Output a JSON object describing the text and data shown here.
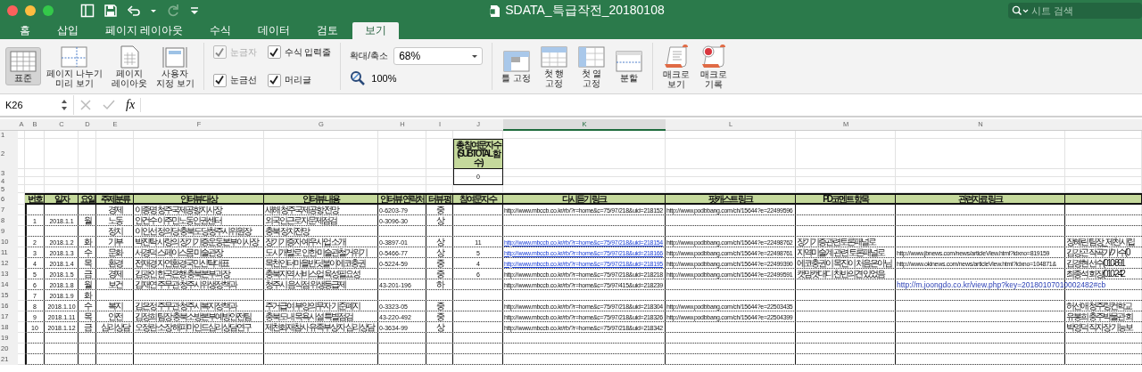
{
  "window": {
    "title": "SDATA_특급작전_20180108",
    "search_placeholder": "시트 검색"
  },
  "tabs": [
    {
      "label": "홈",
      "selected": false
    },
    {
      "label": "삽입",
      "selected": false
    },
    {
      "label": "페이지 레이아웃",
      "selected": false
    },
    {
      "label": "수식",
      "selected": false
    },
    {
      "label": "데이터",
      "selected": false
    },
    {
      "label": "검토",
      "selected": false
    },
    {
      "label": "보기",
      "selected": true
    }
  ],
  "ribbon": {
    "views": [
      {
        "label": "표준",
        "kind": "normal",
        "selected": true
      },
      {
        "label": "페이지 나누기\n미리 보기",
        "kind": "page_break",
        "selected": false
      },
      {
        "label": "페이지\n레이아웃",
        "kind": "page_layout",
        "selected": false
      },
      {
        "label": "사용자\n지정 보기",
        "kind": "custom",
        "selected": false
      }
    ],
    "view_options": [
      {
        "label": "눈금자",
        "checked": true,
        "disabled": true
      },
      {
        "label": "수식 입력줄",
        "checked": true,
        "disabled": false
      },
      {
        "label": "눈금선",
        "checked": true,
        "disabled": false
      },
      {
        "label": "머리글",
        "checked": true,
        "disabled": false
      }
    ],
    "zoom": {
      "label": "확대/축소",
      "value": "68%",
      "reset_label": "100%"
    },
    "freeze": [
      {
        "label": "틀 고정",
        "kind": "panes"
      },
      {
        "label": "첫 행\n고정",
        "kind": "top_row"
      },
      {
        "label": "첫 열\n고정",
        "kind": "first_column"
      },
      {
        "label": "분할",
        "kind": "split"
      }
    ],
    "macros": [
      {
        "label": "매크로\n보기",
        "kind": "view"
      },
      {
        "label": "매크로\n기록",
        "kind": "record"
      }
    ]
  },
  "formula_bar": {
    "cell": "K26",
    "function_label": "fx"
  },
  "sheet": {
    "column_headers": [
      {
        "label": "A",
        "selected": false
      },
      {
        "label": "B",
        "selected": false
      },
      {
        "label": "C",
        "selected": false
      },
      {
        "label": "D",
        "selected": false
      },
      {
        "label": "E",
        "selected": false
      },
      {
        "label": "F",
        "selected": false
      },
      {
        "label": "G",
        "selected": false
      },
      {
        "label": "H",
        "selected": false
      },
      {
        "label": "I",
        "selected": false
      },
      {
        "label": "J",
        "selected": false
      },
      {
        "label": "K",
        "selected": true
      },
      {
        "label": "L",
        "selected": false
      },
      {
        "label": "M",
        "selected": false
      },
      {
        "label": "N",
        "selected": false
      }
    ],
    "row_numbers": [
      "1",
      "2",
      "3",
      "4",
      "5",
      "6",
      "7",
      "8",
      "9",
      "10",
      "11",
      "12",
      "13",
      "14",
      "15",
      "16",
      "17",
      "18",
      "19",
      "20",
      "21"
    ],
    "summary": {
      "label": "총 참여문자 수 (SUBTOTAL 함수)",
      "value": "0"
    },
    "headers": [
      "번호",
      "일자",
      "요일",
      "주제분류",
      "인터뷰 대상",
      "인터뷰 내용",
      "인터뷰 연락처",
      "터뷰 평",
      "참여문자 수",
      "다시듣기 링크",
      "팟캐스트 링크",
      "PD코멘트 항목",
      "관련자료 링크"
    ],
    "entries": [
      {
        "no": "1",
        "date": "2018.1.1",
        "day": "월",
        "lines": [
          {
            "topic": "경제",
            "target": "이종명 청주국제공항지사장",
            "content": "새해 청주국제공항 전망",
            "phone": "0-6203-79",
            "rating": "중",
            "replay": {
              "text": "http://www.mbccb.co.kr/rb/?r=home&c=75/97/218&uid=218152",
              "hyperlink": false
            },
            "podcast": "http://www.podbbang.com/ch/15644?e=22499596"
          },
          {
            "topic": "노동",
            "target": "안건수 이주민노동인권센터",
            "content": "외국인근로자문제점검",
            "phone": "0-3096-30",
            "rating": "상"
          },
          {
            "topic": "정치",
            "target": "이인선 정의당 충북도당 청주시위원장",
            "content": "충북 정치전망"
          }
        ]
      },
      {
        "no": "2",
        "date": "2018.1.2",
        "day": "화",
        "lines": [
          {
            "topic": "기부",
            "target": "박진탁 사랑의 장기기증운동본부 이사장",
            "content": "장기기증자 예우사업 소개",
            "phone": "0-3897-01",
            "rating": "상",
            "count": "11",
            "replay": {
              "text": "http://www.mbccb.co.kr/rb/?r=home&c=75/97/218&uid=218154",
              "hyperlink": true
            },
            "podcast": "http://www.podbbang.com/ch/15644?e=22498762",
            "pd_comment": "장기기증관련토론패널로",
            "guest": "장혜린 팀장_제천시립"
          }
        ]
      },
      {
        "no": "3",
        "date": "2018.1.3",
        "day": "수",
        "lines": [
          {
            "topic": "문화",
            "target": "서경덕 스페이스몸 미술관장",
            "content": "도시개발로 인한 미술관 철거위기",
            "phone": "0-5466-77",
            "rating": "상",
            "count": "5",
            "replay": {
              "text": "http://www.mbccb.co.kr/rb/?r=home&c=75/97/218&uid=218166",
              "hyperlink": true
            },
            "podcast": "http://www.podbbang.com/ch/15644?e=22498761",
            "pd_comment": "지역미술계 관련 토론 패널로",
            "related": {
              "text": "http://www.jbnews.com/news/articleView.html?idxno=819159",
              "hyperlink": false
            },
            "guest": "김강곤 작곡가/가수(0"
          }
        ]
      },
      {
        "no": "4",
        "date": "2018.1.4",
        "day": "목",
        "lines": [
          {
            "topic": "환경",
            "target": "전재경 자연환경국민신탁대표",
            "content": "목천인터마을반딧불이에코충권",
            "phone": "0-5224-59",
            "rating": "중",
            "count": "4",
            "replay": {
              "text": "http://www.mbccb.co.kr/rb/?r=home&c=75/97/218&uid=218195",
              "hyperlink": true
            },
            "podcast": "http://www.podbbang.com/ch/15644?e=22499390",
            "pd_comment": "에코충권이 목진이 처음은 아님",
            "related": {
              "text": "http://www.okinews.com/news/articleView.html?idxno=104871&",
              "hyperlink": false
            },
            "guest": "김경현 선수(010-891"
          }
        ]
      },
      {
        "no": "5",
        "date": "2018.1.5",
        "day": "금",
        "lines": [
          {
            "topic": "경제",
            "target": "김광인 한국은행 충북본부 과장",
            "content": "충북지역 서비스업 육성 필요성",
            "rating": "중",
            "count": "6",
            "replay": {
              "text": "http://www.mbccb.co.kr/rb/?r=home&c=75/97/218&uid=218218",
              "hyperlink": false
            },
            "podcast": "http://www.podbbang.com/ch/15644?e=22499591",
            "pd_comment": "캣맘캣대디 찬반의견 있었음",
            "guest": "최종석 회장(010-242"
          }
        ]
      },
      {
        "no": "6",
        "date": "2018.1.8",
        "day": "월",
        "lines": [
          {
            "topic": "보건",
            "target": "김재연 주무관 청주시 위생정책과",
            "content": "청주시 음식점 위생등급제",
            "phone": "43-201-196",
            "rating": "하",
            "replay": {
              "text": "http://www.mbccb.co.kr/rb/?r=home&c=75/97/415&uid=218239",
              "hyperlink": false
            },
            "related": {
              "text": "http://m.joongdo.co.kr/view.php?key=20180107010002482#cb",
              "hyperlink": true
            }
          }
        ]
      },
      {
        "no": "7",
        "date": "2018.1.9",
        "day": "화"
      },
      {
        "no": "8",
        "date": "2018.1.10",
        "day": "수",
        "lines": [
          {
            "topic": "복지",
            "target": "김은정 주무관 청주시 복지정책과",
            "content": "주거급여 부양의무자 기준 폐지",
            "phone": "0-3323-05",
            "rating": "중",
            "replay": {
              "text": "http://www.mbccb.co.kr/rb/?r=home&c=75/97/218&uid=218304",
              "hyperlink": false
            },
            "podcast": "http://www.podbbang.com/ch/15644?e=22503435",
            "guest": "허선애 청주링컨학교"
          }
        ]
      },
      {
        "no": "9",
        "date": "2018.1.11",
        "day": "목",
        "lines": [
          {
            "topic": "안전",
            "target": "김정희 팀장 충북소방본부 예방안전팀",
            "content": "충북도내 목욕시설 특별점검",
            "phone": "43-220-492",
            "rating": "중",
            "replay": {
              "text": "http://www.mbccb.co.kr/rb/?r=home&c=75/97/218&uid=218326",
              "hyperlink": false
            },
            "podcast": "http://www.podbbang.com/ch/15644?e=22504399",
            "guest": "유봉희 충주박물관 회"
          }
        ]
      },
      {
        "no": "10",
        "date": "2018.1.12",
        "day": "금",
        "lines": [
          {
            "topic": "심리상담",
            "target": "오정란 소장 해피마인드 심리상담연구",
            "content": "제천화재참사 유족부상자 심리상담",
            "phone": "0-3634-99",
            "rating": "상",
            "replay": {
              "text": "http://www.mbccb.co.kr/rb/?r=home&c=75/97/218&uid=218342",
              "hyperlink": false
            },
            "guest": "박영덕 직자장 기능보"
          }
        ]
      }
    ]
  }
}
